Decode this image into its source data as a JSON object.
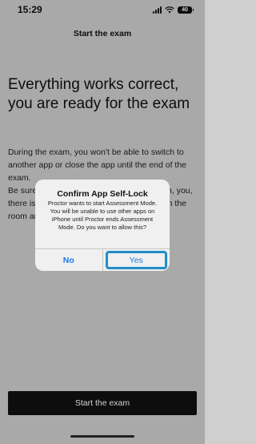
{
  "status_bar": {
    "time": "15:29",
    "battery": "40"
  },
  "header": {
    "title": "Start the exam"
  },
  "main": {
    "headline": "Everything works correct, you are ready for the exam",
    "paragraph_1": "During the exam, you won't be able to switch to another app or close the app until the end of the exam.",
    "paragraph_2": "Be sure to have a stable internet connection, you, there is enough battery and you are alone in the room and..."
  },
  "dialog": {
    "title": "Confirm App Self-Lock",
    "message": "Proctor wants to start Assessment Mode. You will be unable to use other apps on iPhone until Proctor ends Assessment Mode. Do you want to allow this?",
    "no_label": "No",
    "yes_label": "Yes"
  },
  "footer": {
    "button_label": "Start the exam"
  },
  "colors": {
    "accent": "#1a78e8",
    "focus_ring": "#1e8ec9",
    "button_bg": "#101010"
  },
  "icons": [
    "signal-icon",
    "wifi-icon",
    "battery-icon"
  ]
}
